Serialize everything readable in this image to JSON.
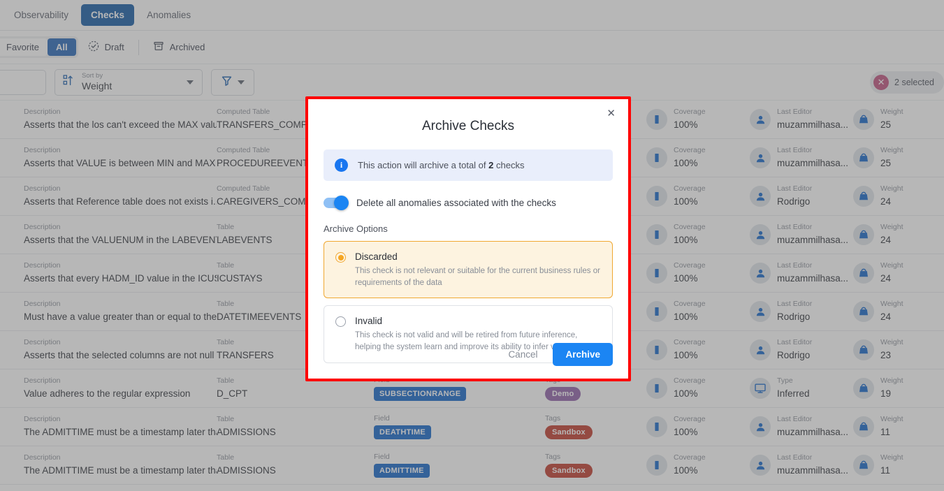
{
  "nav": {
    "tabs": [
      {
        "label": "Observability",
        "active": false
      },
      {
        "label": "Checks",
        "active": true
      },
      {
        "label": "Anomalies",
        "active": false
      }
    ]
  },
  "filters": {
    "favorite_label": "Favorite",
    "all_label": "All",
    "draft_label": "Draft",
    "draft_icon": "dashed-check-circle-icon",
    "archived_label": "Archived",
    "archived_icon": "archive-box-icon"
  },
  "controls": {
    "search_placeholder": "",
    "sort_label": "Sort by",
    "sort_value": "Weight",
    "sort_icon": "sort-ascending-icon",
    "filter_icon": "funnel-icon",
    "selected_text": "2 selected",
    "clear_icon": "close-circle-icon",
    "accent": "#1359a5",
    "chip_color": "#c0507e"
  },
  "table": {
    "labels": {
      "description": "Description",
      "table": "Table",
      "computed_table": "Computed Table",
      "field": "Field",
      "tags": "Tags",
      "coverage": "Coverage",
      "last_editor": "Last Editor",
      "type": "Type",
      "weight": "Weight"
    },
    "rows": [
      {
        "description": "Asserts that the los can't exceed the MAX valu...",
        "table_label": "Computed Table",
        "table_value": "TRANSFERS_COMPUTE",
        "field": "",
        "tag": "",
        "tag_color": "",
        "coverage": "100%",
        "meta_label": "Last Editor",
        "meta_value": "muzammilhasa...",
        "meta_icon": "person-icon",
        "weight": "25"
      },
      {
        "description": "Asserts that VALUE is between MIN and MAX",
        "table_label": "Computed Table",
        "table_value": "PROCEDUREEVENTS_M",
        "field": "",
        "tag": "",
        "tag_color": "",
        "coverage": "100%",
        "meta_label": "Last Editor",
        "meta_value": "muzammilhasa...",
        "meta_icon": "person-icon",
        "weight": "25"
      },
      {
        "description": "Asserts that Reference table does not exists i...",
        "table_label": "Computed Table",
        "table_value": "CAREGIVERS_COMPUT",
        "field": "",
        "tag": "",
        "tag_color": "",
        "coverage": "100%",
        "meta_label": "Last Editor",
        "meta_value": "Rodrigo",
        "meta_icon": "person-icon",
        "weight": "24"
      },
      {
        "description": "Asserts that the VALUENUM in the LABEVENTS...",
        "table_label": "Table",
        "table_value": "LABEVENTS",
        "field": "",
        "tag": "",
        "tag_color": "",
        "coverage": "100%",
        "meta_label": "Last Editor",
        "meta_value": "muzammilhasa...",
        "meta_icon": "person-icon",
        "weight": "24"
      },
      {
        "description": "Asserts that every HADM_ID value in the ICUS...",
        "table_label": "Table",
        "table_value": "ICUSTAYS",
        "field": "",
        "tag": "",
        "tag_color": "",
        "coverage": "100%",
        "meta_label": "Last Editor",
        "meta_value": "muzammilhasa...",
        "meta_icon": "person-icon",
        "weight": "24"
      },
      {
        "description": "Must have a value greater than or equal to the ...",
        "table_label": "Table",
        "table_value": "DATETIMEEVENTS",
        "field": "",
        "tag": "",
        "tag_color": "",
        "coverage": "100%",
        "meta_label": "Last Editor",
        "meta_value": "Rodrigo",
        "meta_icon": "person-icon",
        "weight": "24"
      },
      {
        "description": "Asserts that the selected columns are not null",
        "table_label": "Table",
        "table_value": "TRANSFERS",
        "field": "",
        "tag": "",
        "tag_color": "",
        "coverage": "100%",
        "meta_label": "Last Editor",
        "meta_value": "Rodrigo",
        "meta_icon": "person-icon",
        "weight": "23"
      },
      {
        "description": "Value adheres to the regular expression",
        "table_label": "Table",
        "table_value": "D_CPT",
        "field": "SUBSECTIONRANGE",
        "tag": "Demo",
        "tag_color": "#8f5fa8",
        "coverage": "100%",
        "meta_label": "Type",
        "meta_value": "Inferred",
        "meta_icon": "monitor-icon",
        "weight": "19"
      },
      {
        "description": "The ADMITTIME must be a timestamp later tha...",
        "table_label": "Table",
        "table_value": "ADMISSIONS",
        "field": "DEATHTIME",
        "tag": "Sandbox",
        "tag_color": "#c0392b",
        "coverage": "100%",
        "meta_label": "Last Editor",
        "meta_value": "muzammilhasa...",
        "meta_icon": "person-icon",
        "weight": "11"
      },
      {
        "description": "The ADMITTIME must be a timestamp later tha...",
        "table_label": "Table",
        "table_value": "ADMISSIONS",
        "field": "ADMITTIME",
        "tag": "Sandbox",
        "tag_color": "#c0392b",
        "coverage": "100%",
        "meta_label": "Last Editor",
        "meta_value": "muzammilhasa...",
        "meta_icon": "person-icon",
        "weight": "11"
      }
    ]
  },
  "modal": {
    "title": "Archive Checks",
    "close_icon": "close-icon",
    "info_icon": "info-icon",
    "info_prefix": "This action will archive a total of",
    "info_count": "2",
    "info_suffix": "checks",
    "toggle_label": "Delete all anomalies associated with the checks",
    "toggle_on": true,
    "options_label": "Archive Options",
    "options": [
      {
        "name": "Discarded",
        "description": "This check is not relevant or suitable for the current business rules or requirements of the data",
        "selected": true
      },
      {
        "name": "Invalid",
        "description": "This check is not valid and will be retired from future inference, helping the system learn and improve its ability to infer valid checks",
        "selected": false
      }
    ],
    "cancel_label": "Cancel",
    "archive_label": "Archive",
    "accent": "#1b85f3",
    "highlight_border": "#ff0000",
    "selected_option_color": "#f0a832"
  }
}
